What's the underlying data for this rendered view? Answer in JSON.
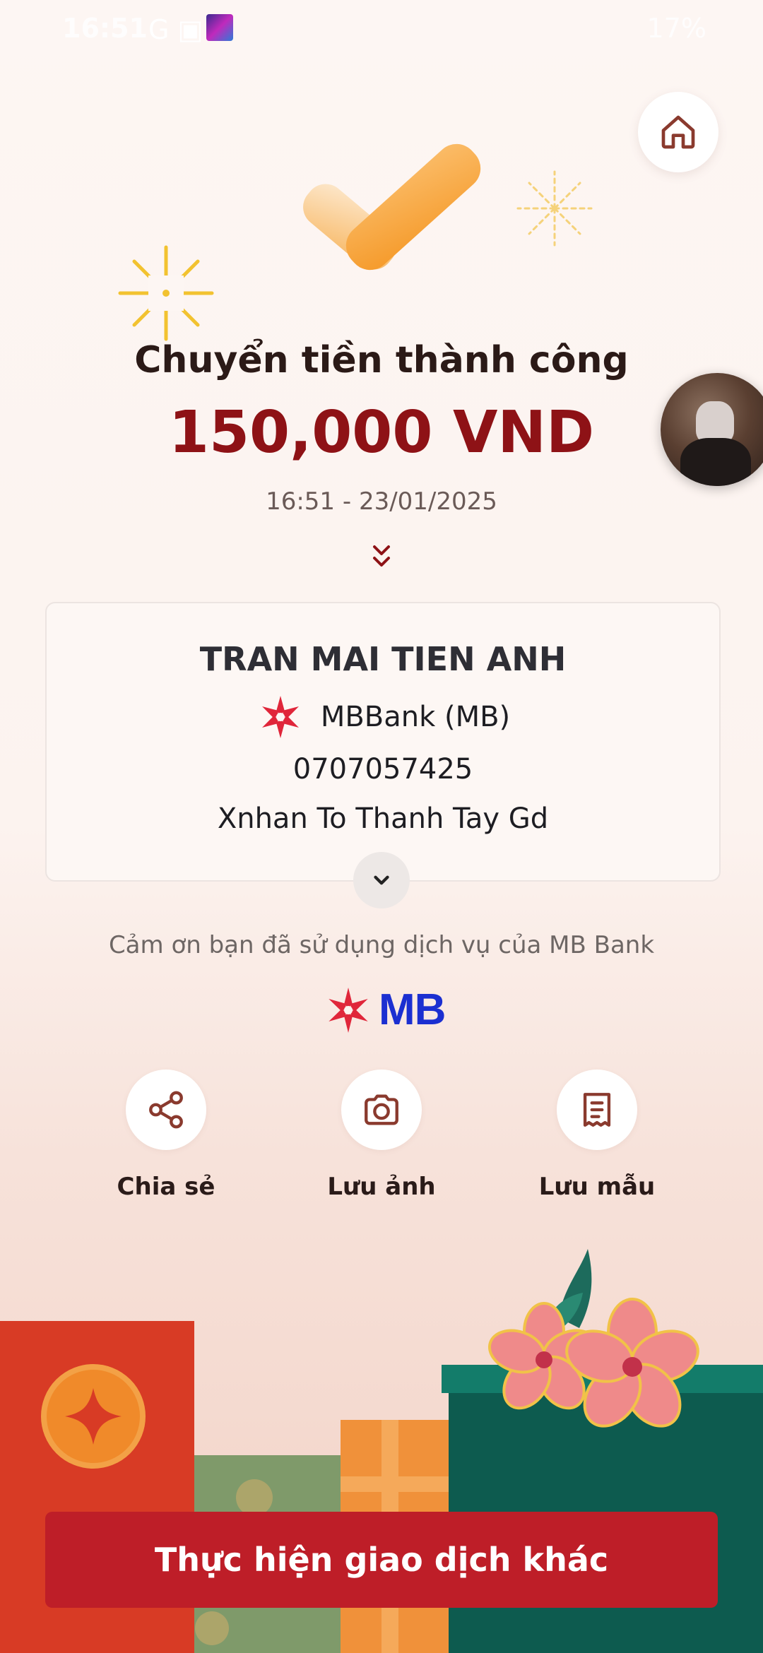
{
  "status_bar": {
    "time": "16:51",
    "left_icons": "G ▣",
    "right_text": "17%"
  },
  "result": {
    "title": "Chuyển tiền thành công",
    "amount": "150,000 VND",
    "datetime": "16:51 - 23/01/2025"
  },
  "recipient": {
    "name": "TRAN MAI TIEN ANH",
    "bank": "MBBank (MB)",
    "account_number": "0707057425",
    "note": "Xnhan To Thanh Tay Gd"
  },
  "thanks_text": "Cảm ơn bạn đã sử dụng dịch vụ của MB Bank",
  "brand_logo_text": "MB",
  "actions": [
    {
      "label": "Chia sẻ",
      "icon": "share-icon"
    },
    {
      "label": "Lưu ảnh",
      "icon": "camera-icon"
    },
    {
      "label": "Lưu mẫu",
      "icon": "receipt-icon"
    }
  ],
  "primary_button": {
    "label": "Thực hiện giao dịch khác"
  },
  "colors": {
    "accent_red": "#be1e28",
    "amount_red": "#8e1216",
    "mb_blue": "#1b2fd1",
    "icon_brown": "#8a3a2e"
  }
}
